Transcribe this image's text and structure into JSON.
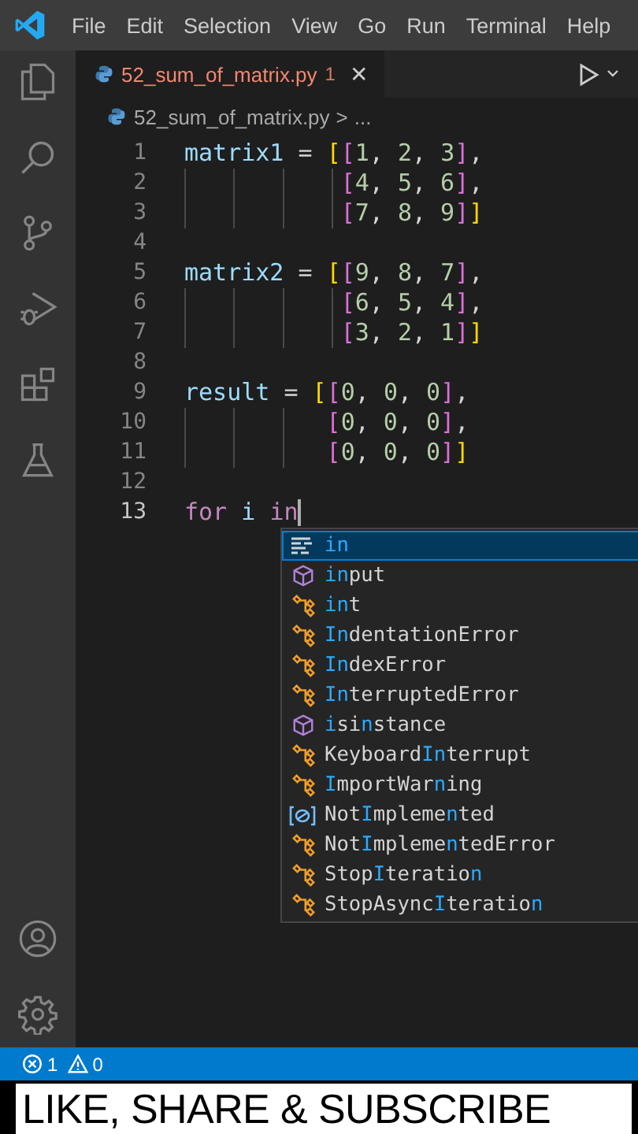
{
  "menu": [
    "File",
    "Edit",
    "Selection",
    "View",
    "Go",
    "Run",
    "Terminal",
    "Help"
  ],
  "tab": {
    "filename": "52_sum_of_matrix.py",
    "problems": "1",
    "close": "✕",
    "has_errors": true
  },
  "breadcrumb": {
    "file": "52_sum_of_matrix.py",
    "separator": ">",
    "more": "..."
  },
  "lines": [
    {
      "number": "1",
      "current": false,
      "continuation": false,
      "tokens": [
        {
          "text": "matrix1",
          "kind": "variable"
        },
        {
          "text": " = ",
          "kind": "operator"
        },
        {
          "text": "[",
          "kind": "bracket1"
        },
        {
          "text": "[",
          "kind": "bracket2"
        },
        {
          "text": "1",
          "kind": "number"
        },
        {
          "text": ", ",
          "kind": "operator"
        },
        {
          "text": "2",
          "kind": "number"
        },
        {
          "text": ", ",
          "kind": "operator"
        },
        {
          "text": "3",
          "kind": "number"
        },
        {
          "text": "]",
          "kind": "bracket2"
        },
        {
          "text": ",",
          "kind": "operator"
        }
      ]
    },
    {
      "number": "2",
      "current": false,
      "continuation": true,
      "tokens": [
        {
          "text": "[",
          "kind": "bracket2"
        },
        {
          "text": "4",
          "kind": "number"
        },
        {
          "text": ", ",
          "kind": "operator"
        },
        {
          "text": "5",
          "kind": "number"
        },
        {
          "text": ", ",
          "kind": "operator"
        },
        {
          "text": "6",
          "kind": "number"
        },
        {
          "text": "]",
          "kind": "bracket2"
        },
        {
          "text": ",",
          "kind": "operator"
        }
      ]
    },
    {
      "number": "3",
      "current": false,
      "continuation": true,
      "tokens": [
        {
          "text": "[",
          "kind": "bracket2"
        },
        {
          "text": "7",
          "kind": "number"
        },
        {
          "text": ", ",
          "kind": "operator"
        },
        {
          "text": "8",
          "kind": "number"
        },
        {
          "text": ", ",
          "kind": "operator"
        },
        {
          "text": "9",
          "kind": "number"
        },
        {
          "text": "]",
          "kind": "bracket2"
        },
        {
          "text": "]",
          "kind": "bracket1"
        }
      ]
    },
    {
      "number": "4",
      "current": false
    },
    {
      "number": "5",
      "current": false,
      "continuation": false,
      "tokens": [
        {
          "text": "matrix2",
          "kind": "variable"
        },
        {
          "text": " = ",
          "kind": "operator"
        },
        {
          "text": "[",
          "kind": "bracket1"
        },
        {
          "text": "[",
          "kind": "bracket2"
        },
        {
          "text": "9",
          "kind": "number"
        },
        {
          "text": ", ",
          "kind": "operator"
        },
        {
          "text": "8",
          "kind": "number"
        },
        {
          "text": ", ",
          "kind": "operator"
        },
        {
          "text": "7",
          "kind": "number"
        },
        {
          "text": "]",
          "kind": "bracket2"
        },
        {
          "text": ",",
          "kind": "operator"
        }
      ]
    },
    {
      "number": "6",
      "current": false,
      "continuation": true,
      "tokens": [
        {
          "text": "[",
          "kind": "bracket2"
        },
        {
          "text": "6",
          "kind": "number"
        },
        {
          "text": ", ",
          "kind": "operator"
        },
        {
          "text": "5",
          "kind": "number"
        },
        {
          "text": ", ",
          "kind": "operator"
        },
        {
          "text": "4",
          "kind": "number"
        },
        {
          "text": "]",
          "kind": "bracket2"
        },
        {
          "text": ",",
          "kind": "operator"
        }
      ]
    },
    {
      "number": "7",
      "current": false,
      "continuation": true,
      "tokens": [
        {
          "text": "[",
          "kind": "bracket2"
        },
        {
          "text": "3",
          "kind": "number"
        },
        {
          "text": ", ",
          "kind": "operator"
        },
        {
          "text": "2",
          "kind": "number"
        },
        {
          "text": ", ",
          "kind": "operator"
        },
        {
          "text": "1",
          "kind": "number"
        },
        {
          "text": "]",
          "kind": "bracket2"
        },
        {
          "text": "]",
          "kind": "bracket1"
        }
      ]
    },
    {
      "number": "8",
      "current": false
    },
    {
      "number": "9",
      "current": false,
      "continuation": false,
      "tokens": [
        {
          "text": "result",
          "kind": "variable"
        },
        {
          "text": " = ",
          "kind": "operator"
        },
        {
          "text": "[",
          "kind": "bracket1"
        },
        {
          "text": "[",
          "kind": "bracket2"
        },
        {
          "text": "0",
          "kind": "number"
        },
        {
          "text": ", ",
          "kind": "operator"
        },
        {
          "text": "0",
          "kind": "number"
        },
        {
          "text": ", ",
          "kind": "operator"
        },
        {
          "text": "0",
          "kind": "number"
        },
        {
          "text": "]",
          "kind": "bracket2"
        },
        {
          "text": ",",
          "kind": "operator"
        }
      ]
    },
    {
      "number": "10",
      "current": false,
      "continuation": true,
      "tokens": [
        {
          "text": "[",
          "kind": "bracket2"
        },
        {
          "text": "0",
          "kind": "number"
        },
        {
          "text": ", ",
          "kind": "operator"
        },
        {
          "text": "0",
          "kind": "number"
        },
        {
          "text": ", ",
          "kind": "operator"
        },
        {
          "text": "0",
          "kind": "number"
        },
        {
          "text": "]",
          "kind": "bracket2"
        },
        {
          "text": ",",
          "kind": "operator"
        }
      ]
    },
    {
      "number": "11",
      "current": false,
      "continuation": true,
      "tokens": [
        {
          "text": "[",
          "kind": "bracket2"
        },
        {
          "text": "0",
          "kind": "number"
        },
        {
          "text": ", ",
          "kind": "operator"
        },
        {
          "text": "0",
          "kind": "number"
        },
        {
          "text": ", ",
          "kind": "operator"
        },
        {
          "text": "0",
          "kind": "number"
        },
        {
          "text": "]",
          "kind": "bracket2"
        },
        {
          "text": "]",
          "kind": "bracket1"
        }
      ]
    },
    {
      "number": "12",
      "current": false
    },
    {
      "number": "13",
      "current": true,
      "continuation": false,
      "tokens": [
        {
          "text": "for ",
          "kind": "keyword"
        },
        {
          "text": "i ",
          "kind": "variable"
        },
        {
          "text": "in",
          "kind": "keyword"
        }
      ]
    }
  ],
  "suggestions": [
    {
      "label": "**in**",
      "kind": "keyword",
      "selected": true
    },
    {
      "label": "**in**put",
      "kind": "function",
      "selected": false
    },
    {
      "label": "**in**t",
      "kind": "class",
      "selected": false
    },
    {
      "label": "**In**dentationError",
      "kind": "class",
      "selected": false
    },
    {
      "label": "**In**dexError",
      "kind": "class",
      "selected": false
    },
    {
      "label": "**In**terruptedError",
      "kind": "class",
      "selected": false
    },
    {
      "label": "**i**si**n**stance",
      "kind": "function",
      "selected": false
    },
    {
      "label": "Keyboard**In**terrupt",
      "kind": "class",
      "selected": false
    },
    {
      "label": "**I**mportWar**n**ing",
      "kind": "class",
      "selected": false
    },
    {
      "label": "Not**I**mpleme**n**ted",
      "kind": "variable",
      "selected": false
    },
    {
      "label": "Not**I**mpleme**n**tedError",
      "kind": "class",
      "selected": false
    },
    {
      "label": "Stop**I**teratio**n**",
      "kind": "class",
      "selected": false
    },
    {
      "label": "StopAsync**I**teratio**n**",
      "kind": "class",
      "selected": false
    }
  ],
  "status_bar": {
    "errors": "1",
    "warnings": "0"
  },
  "caption": "LIKE, SHARE & SUBSCRIBE"
}
